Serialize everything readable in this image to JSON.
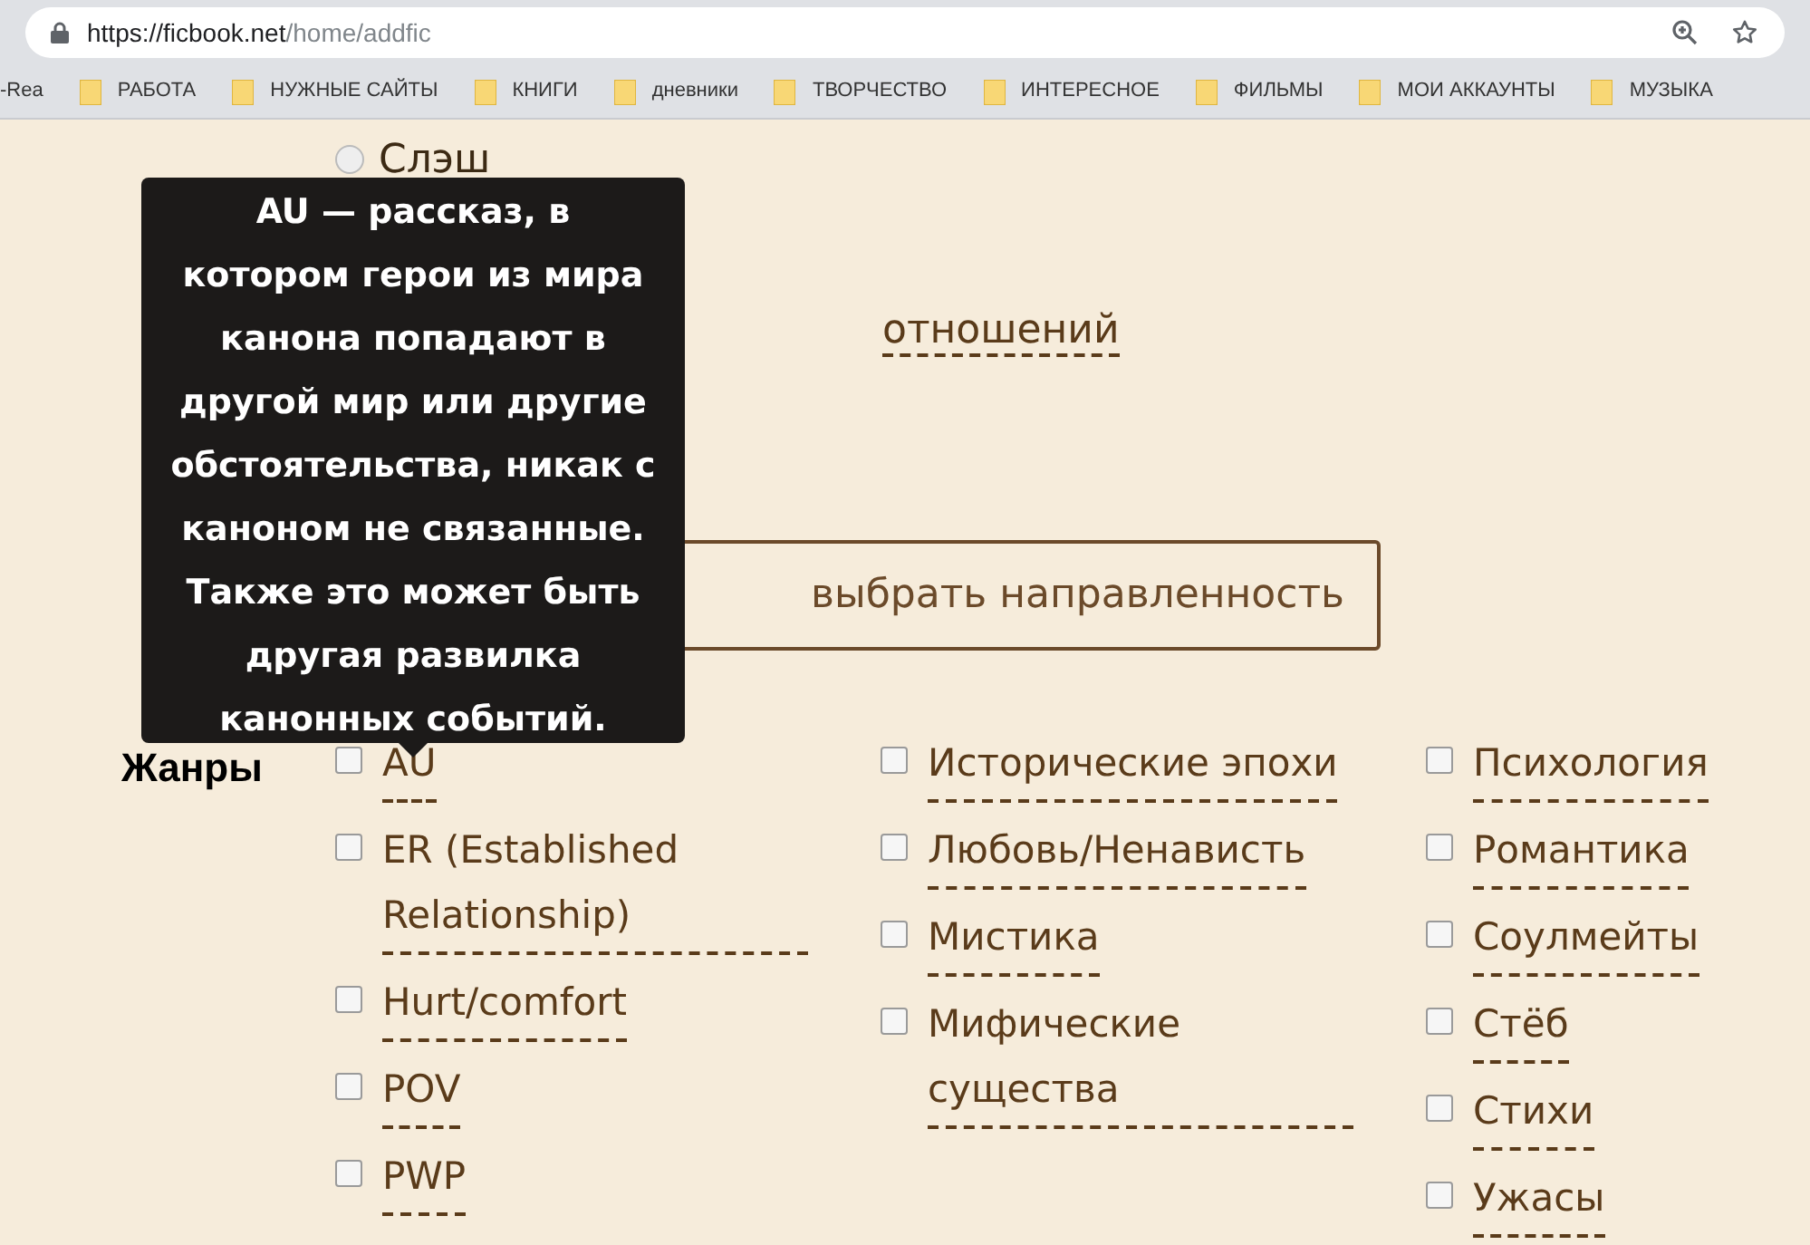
{
  "browser": {
    "url_host": "https://ficbook.net",
    "url_path": "/home/addfic",
    "bookmarks": [
      {
        "label": "-Rea",
        "folder": false
      },
      {
        "label": "РАБОТА",
        "folder": true
      },
      {
        "label": "НУЖНЫЕ САЙТЫ",
        "folder": true
      },
      {
        "label": "КНИГИ",
        "folder": true
      },
      {
        "label": "дневники",
        "folder": true
      },
      {
        "label": "ТВОРЧЕСТВО",
        "folder": true
      },
      {
        "label": "ИНТЕРЕСНОЕ",
        "folder": true
      },
      {
        "label": "ФИЛЬМЫ",
        "folder": true
      },
      {
        "label": "МОИ АККАУНТЫ",
        "folder": true
      },
      {
        "label": "МУЗЫКА",
        "folder": true
      }
    ]
  },
  "direction": {
    "options": [
      {
        "label": "Слэш",
        "selected": false
      }
    ],
    "link_fragment": "отношений",
    "help_button": "выбрать направленность"
  },
  "tooltip": {
    "text": "**AU** — рассказ, в котором герои из мира канона попадают в другой мир или другие обстоятельства, никак с каноном не связанные. Также это может быть другая развилка канонных событий."
  },
  "genres": {
    "label": "Жанры",
    "columns": [
      [
        {
          "label": "AU",
          "checked": false
        },
        {
          "label": "ER (Established Relationship)",
          "checked": false
        },
        {
          "label": "Hurt/comfort",
          "checked": false
        },
        {
          "label": "POV",
          "checked": false
        },
        {
          "label": "PWP",
          "checked": false
        }
      ],
      [
        {
          "label": "Исторические эпохи",
          "checked": false
        },
        {
          "label": "Любовь/Ненависть",
          "checked": false
        },
        {
          "label": "Мистика",
          "checked": false
        },
        {
          "label": "Мифические существа",
          "checked": false
        }
      ],
      [
        {
          "label": "Психология",
          "checked": false
        },
        {
          "label": "Романтика",
          "checked": false
        },
        {
          "label": "Соулмейты",
          "checked": false
        },
        {
          "label": "Стёб",
          "checked": false
        },
        {
          "label": "Стихи",
          "checked": false
        },
        {
          "label": "Ужасы",
          "checked": false
        }
      ]
    ]
  }
}
